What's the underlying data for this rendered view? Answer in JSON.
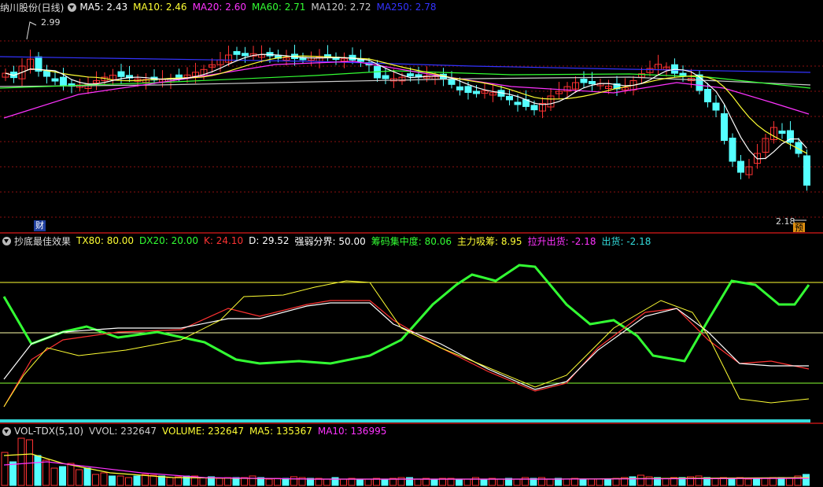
{
  "main_panel": {
    "stock_name": "纳川股份(日线)",
    "ma_labels": [
      {
        "text": "MA5: 2.43",
        "color": "#ffffff"
      },
      {
        "text": "MA10: 2.46",
        "color": "#ffff33"
      },
      {
        "text": "MA20: 2.60",
        "color": "#ff33ff"
      },
      {
        "text": "MA60: 2.71",
        "color": "#33ff33"
      },
      {
        "text": "MA120: 2.72",
        "color": "#cccccc"
      },
      {
        "text": "MA250: 2.78",
        "color": "#3333ff"
      }
    ],
    "high_label": "2.99",
    "low_label": "2.18",
    "finance_tag": "财",
    "forecast_tag": "预"
  },
  "indicator_panel": {
    "title": "抄底最佳效果",
    "labels": [
      {
        "text": "TX80: 80.00",
        "color": "#ffff33"
      },
      {
        "text": "DX20: 20.00",
        "color": "#33ff33"
      },
      {
        "text": "K: 24.10",
        "color": "#ff3333"
      },
      {
        "text": "D: 29.52",
        "color": "#ffffff"
      },
      {
        "text": "强弱分界: 50.00",
        "color": "#ffffff"
      },
      {
        "text": "筹码集中度: 80.06",
        "color": "#33ff33"
      },
      {
        "text": "主力吸筹: 8.95",
        "color": "#ffff33"
      },
      {
        "text": "拉升出货: -2.18",
        "color": "#ff33ff"
      },
      {
        "text": "出货: -2.18",
        "color": "#33dddd"
      }
    ]
  },
  "volume_panel": {
    "title": "VOL-TDX(5,10)",
    "labels": [
      {
        "text": "VVOL: 232647",
        "color": "#cccccc"
      },
      {
        "text": "VOLUME: 232647",
        "color": "#ffff33"
      },
      {
        "text": "MA5: 135367",
        "color": "#ffff33"
      },
      {
        "text": "MA10: 136995",
        "color": "#ff33ff"
      }
    ]
  },
  "colors": {
    "up": "#ff3232",
    "down": "#54ffff",
    "grid": "#8b1010",
    "ma5": "#ffffff",
    "ma10": "#ffff33",
    "ma20": "#ff33ff",
    "ma60": "#33ff33",
    "ma120": "#cccccc",
    "ma250": "#3333ff"
  }
}
